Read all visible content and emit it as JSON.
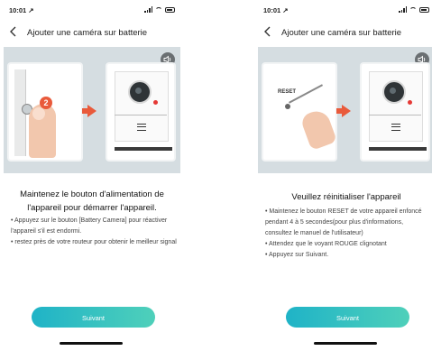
{
  "screens": [
    {
      "status": {
        "time": "10:01 ↗"
      },
      "nav": {
        "back_icon": "chevron-left-icon",
        "title": "Ajouter une caméra sur batterie"
      },
      "illustration": {
        "badge": "2",
        "speaker_icon": "speaker-icon",
        "accent_color": "#e95a3b"
      },
      "heading": "Maintenez le bouton d'alimentation de l'appareil pour démarrer l'appareil.",
      "bullets": [
        "• Appuyez sur le bouton [Battery Camera] pour réactiver l'appareil s'il est endormi.",
        "• restez près de votre routeur pour obtenir le meilleur signal"
      ],
      "cta": "Suivant"
    },
    {
      "status": {
        "time": "10:01 ↗"
      },
      "nav": {
        "back_icon": "chevron-left-icon",
        "title": "Ajouter une caméra sur batterie"
      },
      "illustration": {
        "reset_label": "RESET",
        "speaker_icon": "speaker-icon",
        "accent_color": "#e95a3b"
      },
      "heading": "Veuillez réinitialiser l'appareil",
      "bullets": [
        "• Maintenez le bouton RESET de votre appareil enfoncé pendant 4 à 5 secondes(pour plus d'informations, consultez le manuel de l'utilisateur)",
        "• Attendez que le voyant ROUGE clignotant",
        "• Appuyez sur Suivant."
      ],
      "cta": "Suivant"
    }
  ],
  "colors": {
    "button_start": "#1fb3c7",
    "button_end": "#4fd0ba",
    "illustration_bg": "#d5dde1",
    "red_led": "#e53935"
  }
}
